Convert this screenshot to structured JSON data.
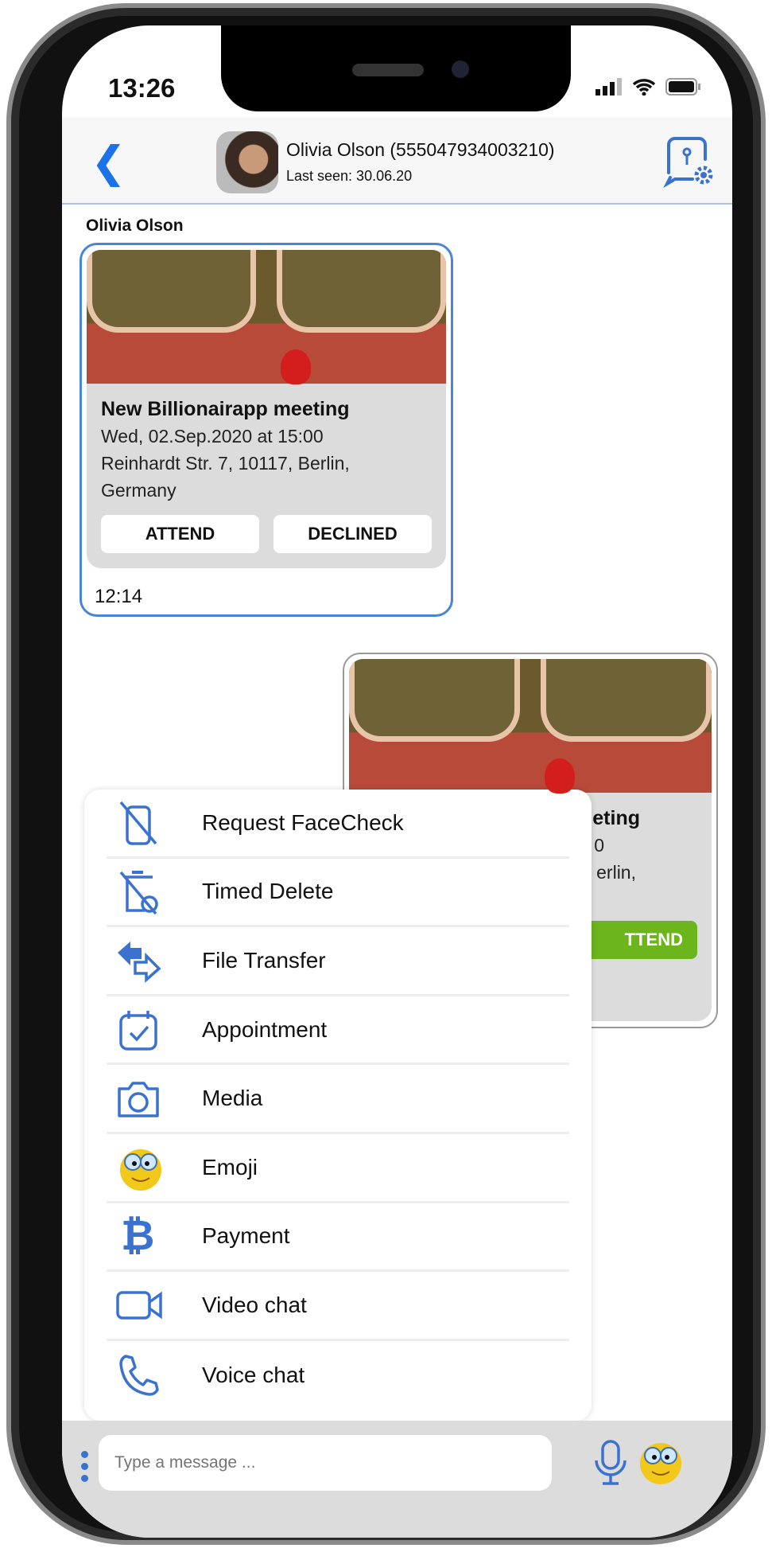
{
  "status_bar": {
    "time": "13:26"
  },
  "header": {
    "contact_name": "Olivia Olson (555047934003210)",
    "last_seen": "Last seen: 30.06.20"
  },
  "chat": {
    "sender_label": "Olivia Olson",
    "messages": [
      {
        "title": "New Billionairapp meeting",
        "datetime": "Wed, 02.Sep.2020 at 15:00",
        "address_line1": "Reinhardt Str. 7, 10117, Berlin,",
        "address_line2": "Germany",
        "attend_label": "ATTEND",
        "decline_label": "DECLINED",
        "time": "12:14"
      },
      {
        "title_partial": "eting",
        "datetime_partial": "0",
        "address_partial": "erlin,",
        "attend_label": "TTEND"
      }
    ]
  },
  "menu": {
    "items": [
      {
        "label": "Request FaceCheck",
        "icon": "facecheck-icon"
      },
      {
        "label": "Timed Delete",
        "icon": "timed-delete-icon"
      },
      {
        "label": "File Transfer",
        "icon": "file-transfer-icon"
      },
      {
        "label": "Appointment",
        "icon": "calendar-check-icon"
      },
      {
        "label": "Media",
        "icon": "camera-icon"
      },
      {
        "label": "Emoji",
        "icon": "emoji-icon"
      },
      {
        "label": "Payment",
        "icon": "bitcoin-icon"
      },
      {
        "label": "Video chat",
        "icon": "video-camera-icon"
      },
      {
        "label": "Voice chat",
        "icon": "phone-icon"
      }
    ]
  },
  "composer": {
    "placeholder": "Type a message ..."
  },
  "colors": {
    "accent": "#3b72d0",
    "attend_green": "#6cb51c",
    "bubble_border": "#4a86d8"
  }
}
